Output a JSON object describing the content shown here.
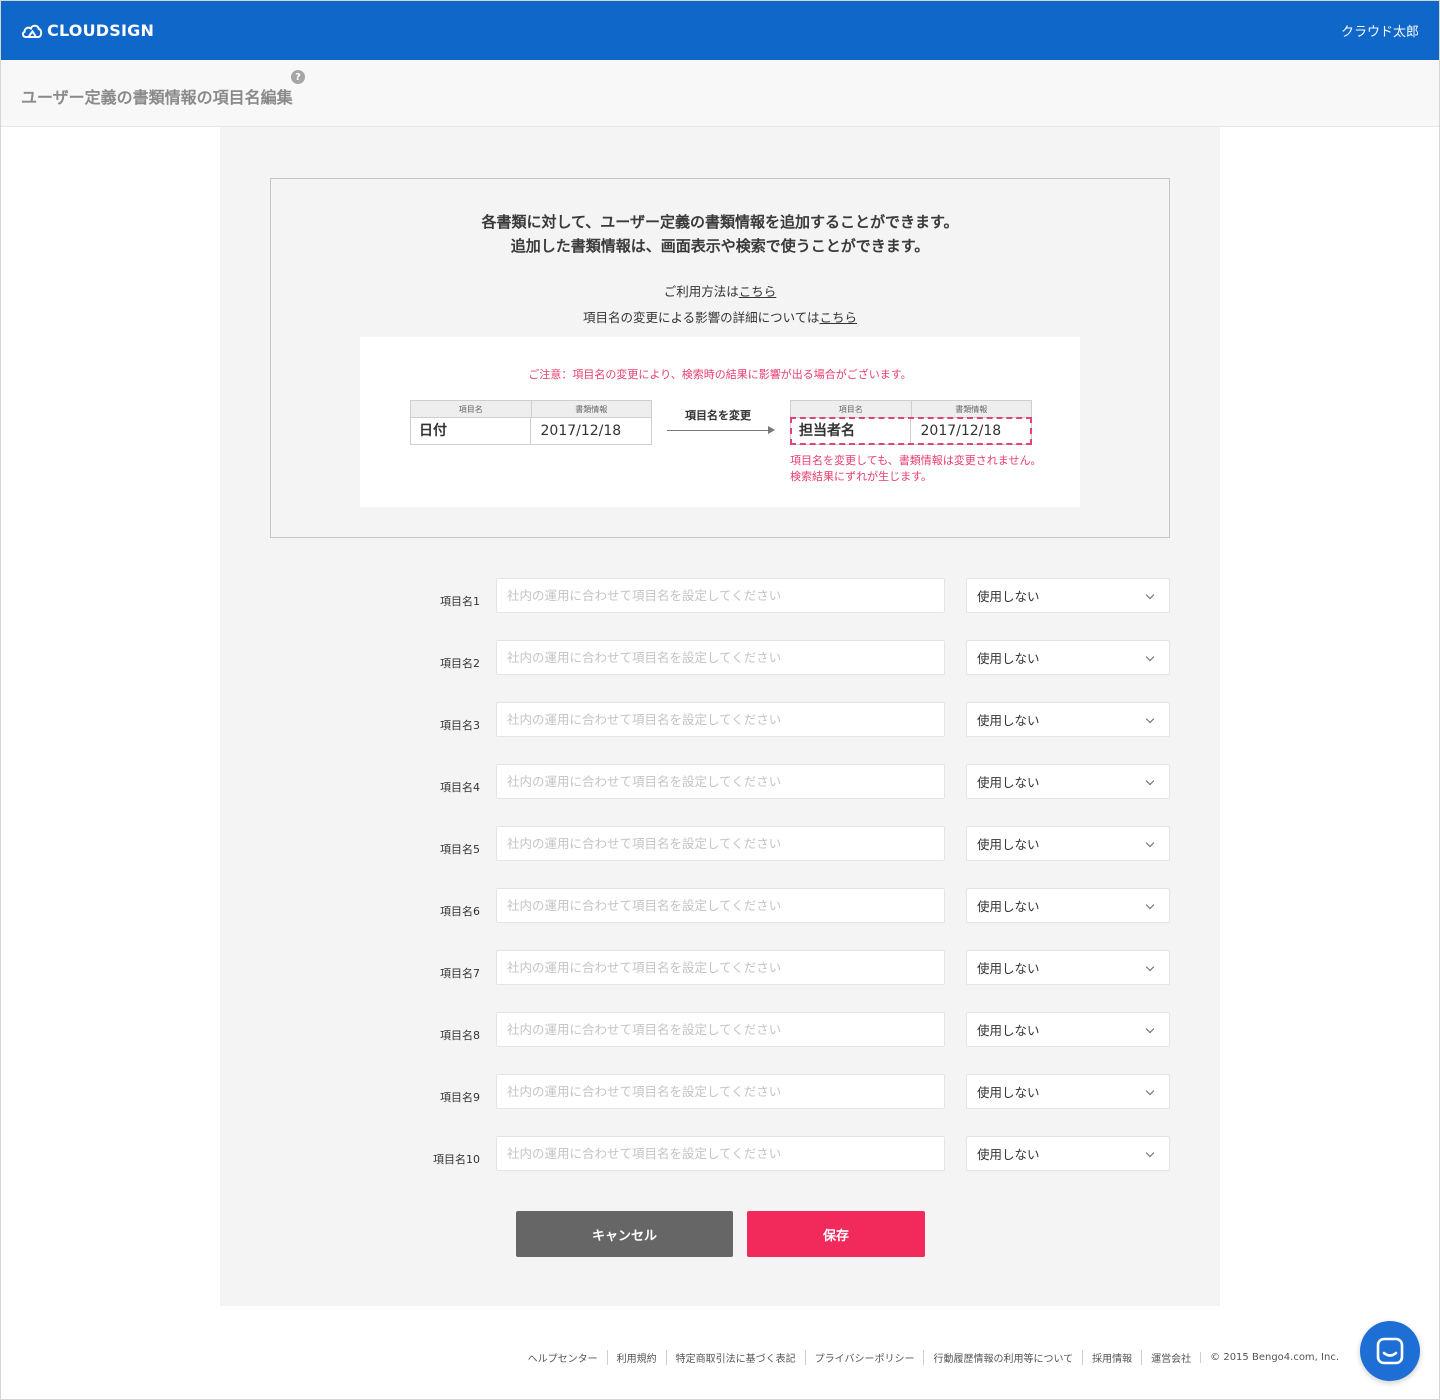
{
  "header": {
    "logo_text": "CLOUDSIGN",
    "username": "クラウド太郎",
    "brand_color": "#0f67c9"
  },
  "title": {
    "text": "ユーザー定義の書類情報の項目名編集",
    "help": "?"
  },
  "info": {
    "line1": "各書類に対して、ユーザー定義の書類情報を追加することができます。",
    "line2": "追加した書類情報は、画面表示や検索で使うことができます。",
    "usage_prefix": "ご利用方法は",
    "usage_link": "こちら",
    "impact_prefix": "項目名の変更による影響の詳細については",
    "impact_link": "こちら",
    "example": {
      "caution": "ご注意：項目名の変更により、検索時の結果に影響が出る場合がございます。",
      "col_name": "項目名",
      "col_value": "書類情報",
      "before_key": "日付",
      "before_value": "2017/12/18",
      "arrow_label": "項目名を変更",
      "after_key": "担当者名",
      "after_value": "2017/12/18",
      "note": "項目名を変更しても、書類情報は変更されません。検索結果にずれが生じます。"
    }
  },
  "form": {
    "placeholder": "社内の運用に合わせて項目名を設定してください",
    "rows": [
      {
        "label": "項目名1",
        "select": "使用しない"
      },
      {
        "label": "項目名2",
        "select": "使用しない"
      },
      {
        "label": "項目名3",
        "select": "使用しない"
      },
      {
        "label": "項目名4",
        "select": "使用しない"
      },
      {
        "label": "項目名5",
        "select": "使用しない"
      },
      {
        "label": "項目名6",
        "select": "使用しない"
      },
      {
        "label": "項目名7",
        "select": "使用しない"
      },
      {
        "label": "項目名8",
        "select": "使用しない"
      },
      {
        "label": "項目名9",
        "select": "使用しない"
      },
      {
        "label": "項目名10",
        "select": "使用しない"
      }
    ],
    "cancel_label": "キャンセル",
    "save_label": "保存",
    "save_color": "#f2295b"
  },
  "footer": {
    "links": [
      "ヘルプセンター",
      "利用規約",
      "特定商取引法に基づく表記",
      "プライバシーポリシー",
      "行動履歴情報の利用等について",
      "採用情報",
      "運営会社"
    ],
    "copyright": "© 2015 Bengo4.com, Inc."
  },
  "chat": {
    "icon": "chat-icon"
  }
}
